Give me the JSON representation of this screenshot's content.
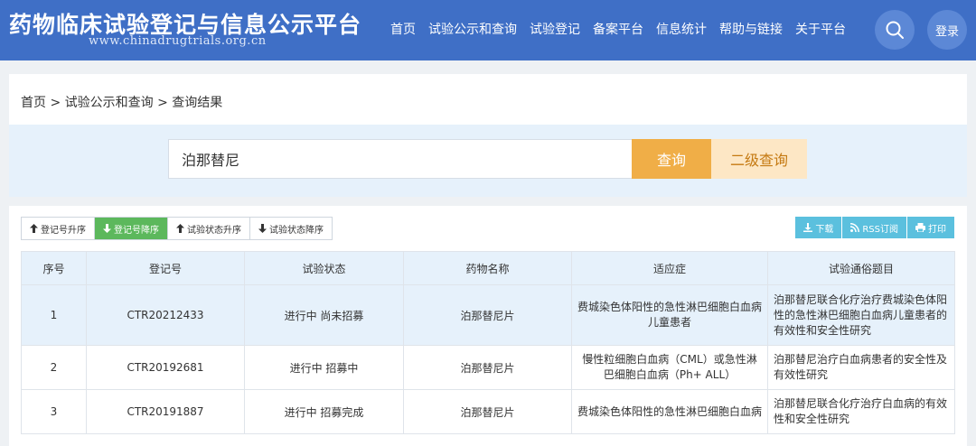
{
  "header": {
    "title": "药物临床试验登记与信息公示平台",
    "url": "www.chinadrugtrials.org.cn",
    "nav": [
      "首页",
      "试验公示和查询",
      "试验登记",
      "备案平台",
      "信息统计",
      "帮助与链接",
      "关于平台"
    ],
    "login_label": "登录"
  },
  "breadcrumb": "首页 > 试验公示和查询 > 查询结果",
  "search": {
    "value": "泊那替尼",
    "query_label": "查询",
    "advanced_label": "二级查询"
  },
  "sort_buttons": [
    {
      "label": "登记号升序",
      "icon": "arrow-up-icon",
      "active": false
    },
    {
      "label": "登记号降序",
      "icon": "arrow-down-icon",
      "active": true
    },
    {
      "label": "试验状态升序",
      "icon": "arrow-up-icon",
      "active": false
    },
    {
      "label": "试验状态降序",
      "icon": "arrow-down-icon",
      "active": false
    }
  ],
  "actions": [
    {
      "label": "下载",
      "icon": "download-icon"
    },
    {
      "label": "RSS订阅",
      "icon": "rss-icon"
    },
    {
      "label": "打印",
      "icon": "print-icon"
    }
  ],
  "table": {
    "columns": [
      "序号",
      "登记号",
      "试验状态",
      "药物名称",
      "适应症",
      "试验通俗题目"
    ],
    "rows": [
      [
        "1",
        "CTR20212433",
        "进行中 尚未招募",
        "泊那替尼片",
        "费城染色体阳性的急性淋巴细胞白血病儿童患者",
        "泊那替尼联合化疗治疗费城染色体阳性的急性淋巴细胞白血病儿童患者的有效性和安全性研究"
      ],
      [
        "2",
        "CTR20192681",
        "进行中 招募中",
        "泊那替尼片",
        "慢性粒细胞白血病（CML）或急性淋巴细胞白血病（Ph+ ALL）",
        "泊那替尼治疗白血病患者的安全性及有效性研究"
      ],
      [
        "3",
        "CTR20191887",
        "进行中 招募完成",
        "泊那替尼片",
        "费城染色体阳性的急性淋巴细胞白血病",
        "泊那替尼联合化疗治疗白血病的有效性和安全性研究"
      ]
    ]
  },
  "colors": {
    "header_bg": "#3f6fc6",
    "query_btn": "#f0ae47",
    "advanced_btn": "#fde7c5",
    "active_sort": "#5cb85c",
    "action_btn": "#5bc0de"
  }
}
